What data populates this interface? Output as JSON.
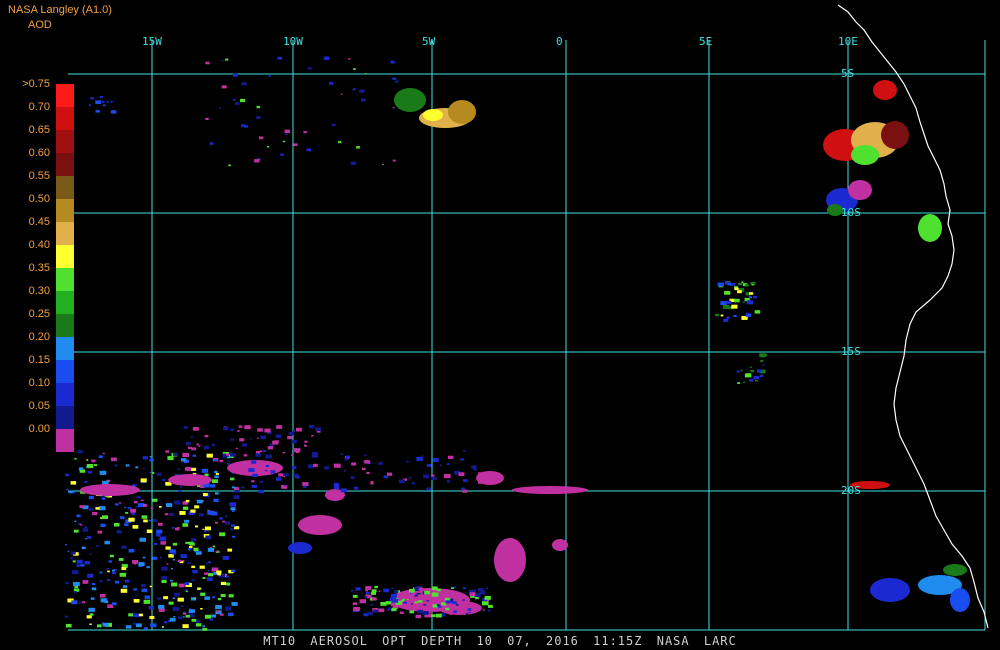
{
  "header": {
    "source": "NASA Langley (A1.0)",
    "variable": "AOD"
  },
  "longitude_labels": [
    "15W",
    "10W",
    "5W",
    "0",
    "5E",
    "10E"
  ],
  "latitude_labels": [
    "5S",
    "10S",
    "15S",
    "20S"
  ],
  "legend": {
    "labels": [
      ">0.75",
      "0.70",
      "0.65",
      "0.60",
      "0.55",
      "0.50",
      "0.45",
      "0.40",
      "0.35",
      "0.30",
      "0.25",
      "0.20",
      "0.15",
      "0.10",
      "0.05",
      "0.00"
    ],
    "colors": [
      "#ff1a1a",
      "#d01010",
      "#a01010",
      "#7a1010",
      "#7a5a18",
      "#b58a20",
      "#e0b04a",
      "#ffff30",
      "#50e030",
      "#20b020",
      "#1a7a1a",
      "#208cf0",
      "#1a4df0",
      "#1a2ad0",
      "#121a90",
      "#c030a0"
    ]
  },
  "footer": {
    "product": "MT10",
    "title": "AEROSOL OPT DEPTH",
    "date": "10 07, 2016 11:15Z",
    "org": "NASA LARC"
  },
  "colors": {
    "grid": "#40e0e0",
    "coast": "#ffffff",
    "background": "#000000",
    "label": "#f0a040"
  }
}
